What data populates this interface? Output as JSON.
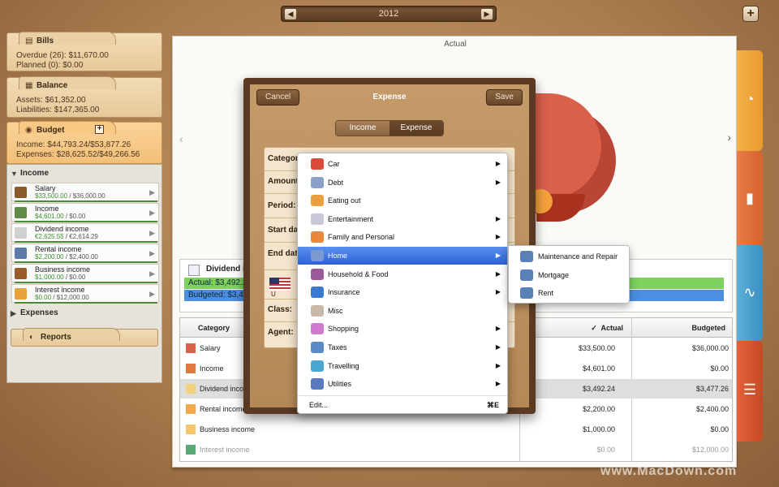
{
  "topbar": {
    "year": "2012",
    "prev_glyph": "◀",
    "next_glyph": "▶",
    "add_glyph": "+"
  },
  "sidebar": {
    "bills": {
      "title": "Bills",
      "overdue": "Overdue (26): $11,670.00",
      "planned": "Planned (0): $0.00"
    },
    "balance": {
      "title": "Balance",
      "assets": "Assets: $61,352.00",
      "liabilities": "Liabilities: $147,365.00"
    },
    "budget": {
      "title": "Budget",
      "plus": "+",
      "income": "Income: $44,793.24/$53,877.26",
      "expenses": "Expenses: $28,625.52/$49,266.56"
    },
    "income_group": "Income",
    "income_items": [
      {
        "name": "Salary",
        "actual": "$33,500.00",
        "sep": " / ",
        "budget": "$36,000.00",
        "color": "#8a5a2a"
      },
      {
        "name": "Income",
        "actual": "$4,601.00",
        "sep": " / ",
        "budget": "$0.00",
        "color": "#5e8a4a"
      },
      {
        "name": "Dividend income",
        "actual": "€2,625.55",
        "sep": " / ",
        "budget": "€2,614.29",
        "color": "#d0d0d0"
      },
      {
        "name": "Rental income",
        "actual": "$2,200.00",
        "sep": " / ",
        "budget": "$2,400.00",
        "color": "#5b7aa8"
      },
      {
        "name": "Business income",
        "actual": "$1,000.00",
        "sep": " / ",
        "budget": "$0.00",
        "color": "#9a5a2a"
      },
      {
        "name": "Interest income",
        "actual": "$0.00",
        "sep": " / ",
        "budget": "$12,000.00",
        "color": "#e8a23a"
      }
    ],
    "expenses_group": "Expenses",
    "reports": "Reports"
  },
  "main": {
    "title": "Actual",
    "dividend_title": "Dividend in",
    "actual_bar_label": "Actual: $3,492.2",
    "budget_bar_label": "Budgeted: $3,47",
    "table": {
      "headers": {
        "category": "Category",
        "actual": "Actual",
        "budgeted": "Budgeted",
        "check": "✓"
      },
      "rows": [
        {
          "name": "Salary",
          "actual": "$33,500.00",
          "budgeted": "$36,000.00",
          "color": "#d9604a"
        },
        {
          "name": "Income",
          "actual": "$4,601.00",
          "budgeted": "$0.00",
          "color": "#e07a3c"
        },
        {
          "name": "Dividend inco",
          "actual": "$3,492.24",
          "budgeted": "$3,477.26",
          "color": "#f2d17a"
        },
        {
          "name": "Rental income",
          "actual": "$2,200.00",
          "budgeted": "$2,400.00",
          "color": "#f1a94a"
        },
        {
          "name": "Business income",
          "actual": "$1,000.00",
          "budgeted": "$0.00",
          "color": "#f7c56a"
        },
        {
          "name": "Interest income",
          "actual": "$0.00",
          "budgeted": "$12,000.00",
          "color": "#5aa874"
        }
      ]
    }
  },
  "dialog": {
    "cancel": "Cancel",
    "title": "Expense",
    "save": "Save",
    "seg_income": "Income",
    "seg_expense": "Expense",
    "labels": {
      "category": "Category",
      "amount": "Amount",
      "period": "Period:",
      "start_date": "Start dat",
      "end_date": "End date",
      "class": "Class:",
      "agent": "Agent:"
    },
    "currency_hint": "U"
  },
  "menu": {
    "items": [
      {
        "label": "Car",
        "submenu": true,
        "color": "#d94a3a"
      },
      {
        "label": "Debt",
        "submenu": true,
        "color": "#8aa0c8"
      },
      {
        "label": "Eating out",
        "submenu": false,
        "color": "#e8a040"
      },
      {
        "label": "Entertainment",
        "submenu": true,
        "color": "#c8c8d8"
      },
      {
        "label": "Family and Personal",
        "submenu": true,
        "color": "#e8883a"
      },
      {
        "label": "Home",
        "submenu": true,
        "color": "#7a9ad0"
      },
      {
        "label": "Household & Food",
        "submenu": true,
        "color": "#9a5a9a"
      },
      {
        "label": "Insurance",
        "submenu": true,
        "color": "#3a7ad0"
      },
      {
        "label": "Misc",
        "submenu": false,
        "color": "#c8b8a8"
      },
      {
        "label": "Shopping",
        "submenu": true,
        "color": "#d07ad0"
      },
      {
        "label": "Taxes",
        "submenu": true,
        "color": "#5a8ac8"
      },
      {
        "label": "Travelling",
        "submenu": true,
        "color": "#4aa8d0"
      },
      {
        "label": "Utilities",
        "submenu": true,
        "color": "#5a7ac0"
      }
    ],
    "edit": "Edit...",
    "edit_shortcut": "⌘E",
    "submenu_arrow": "▶"
  },
  "submenu": {
    "items": [
      "Maintenance and Repair",
      "Mortgage",
      "Rent"
    ]
  },
  "watermark": "www.MacDown.com"
}
